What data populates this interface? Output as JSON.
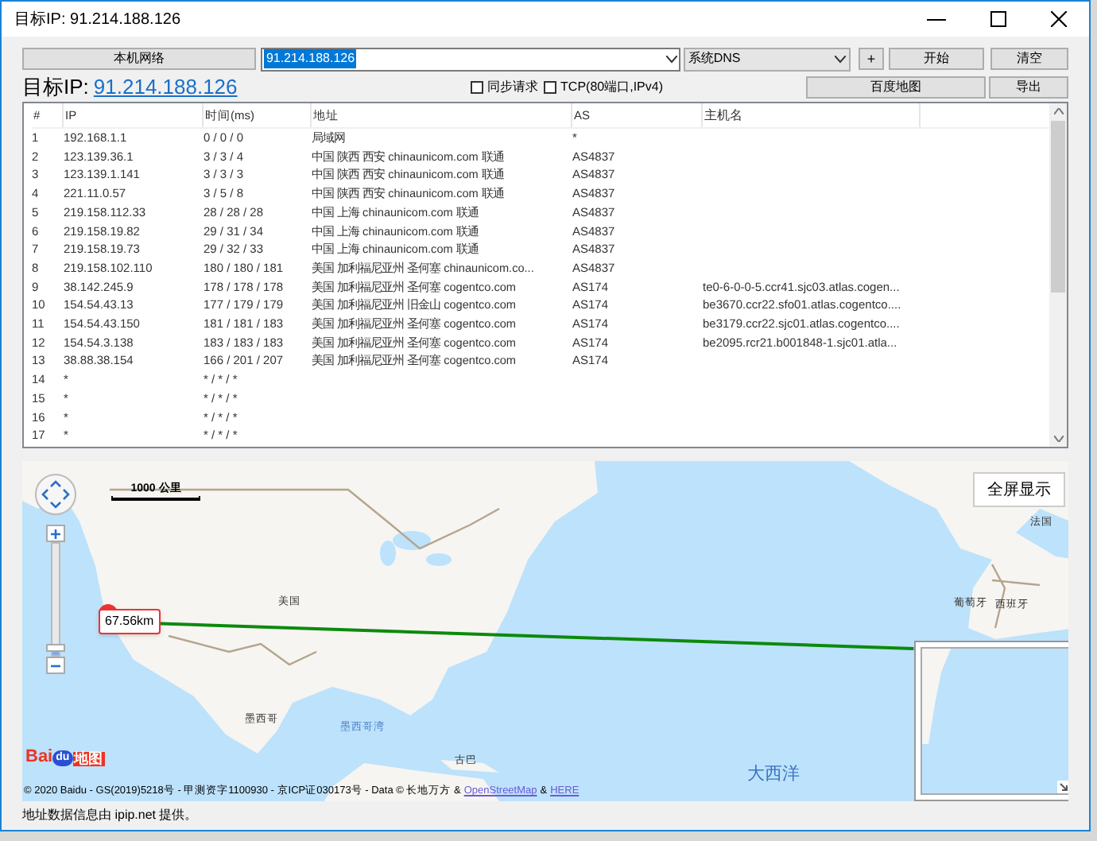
{
  "window": {
    "title": "目标IP: 91.214.188.126"
  },
  "toolbar": {
    "local_network_button": "本机网络",
    "ip_field": {
      "value": "91.214.188.126"
    },
    "dns_select": "系统DNS",
    "add_button": "+",
    "start_button": "开始",
    "clear_button": "清空"
  },
  "target": {
    "label": "目标IP:",
    "ip_link": "91.214.188.126"
  },
  "options": [
    {
      "label": "同步请求",
      "checked": false
    },
    {
      "label": "TCP(80端口,IPv4)",
      "checked": false
    }
  ],
  "map_button": "百度地图",
  "export_button": "导出",
  "table": {
    "columns": [
      "#",
      "IP",
      "时间(ms)",
      "地址",
      "AS",
      "主机名"
    ],
    "rows": [
      [
        "1",
        "192.168.1.1",
        "0 / 0 / 0",
        "局域网",
        "*",
        ""
      ],
      [
        "2",
        "123.139.36.1",
        "3 / 3 / 4",
        "中国 陕西 西安 chinaunicom.com 联通",
        "AS4837",
        ""
      ],
      [
        "3",
        "123.139.1.141",
        "3 / 3 / 3",
        "中国 陕西 西安 chinaunicom.com 联通",
        "AS4837",
        ""
      ],
      [
        "4",
        "221.11.0.57",
        "3 / 5 / 8",
        "中国 陕西 西安 chinaunicom.com 联通",
        "AS4837",
        ""
      ],
      [
        "5",
        "219.158.112.33",
        "28 / 28 / 28",
        "中国 上海 chinaunicom.com 联通",
        "AS4837",
        ""
      ],
      [
        "6",
        "219.158.19.82",
        "29 / 31 / 34",
        "中国 上海 chinaunicom.com 联通",
        "AS4837",
        ""
      ],
      [
        "7",
        "219.158.19.73",
        "29 / 32 / 33",
        "中国 上海 chinaunicom.com 联通",
        "AS4837",
        ""
      ],
      [
        "8",
        "219.158.102.110",
        "180 / 180 / 181",
        "美国 加利福尼亚州 圣何塞 chinaunicom.co...",
        "AS4837",
        ""
      ],
      [
        "9",
        "38.142.245.9",
        "178 / 178 / 178",
        "美国 加利福尼亚州 圣何塞 cogentco.com",
        "AS174",
        "te0-6-0-0-5.ccr41.sjc03.atlas.cogen..."
      ],
      [
        "10",
        "154.54.43.13",
        "177 / 179 / 179",
        "美国 加利福尼亚州 旧金山 cogentco.com",
        "AS174",
        "be3670.ccr22.sfo01.atlas.cogentco...."
      ],
      [
        "11",
        "154.54.43.150",
        "181 / 181 / 183",
        "美国 加利福尼亚州 圣何塞 cogentco.com",
        "AS174",
        "be3179.ccr22.sjc01.atlas.cogentco...."
      ],
      [
        "12",
        "154.54.3.138",
        "183 / 183 / 183",
        "美国 加利福尼亚州 圣何塞 cogentco.com",
        "AS174",
        "be2095.rcr21.b001848-1.sjc01.atla..."
      ],
      [
        "13",
        "38.88.38.154",
        "166 / 201 / 207",
        "美国 加利福尼亚州 圣何塞 cogentco.com",
        "AS174",
        ""
      ],
      [
        "14",
        "*",
        "* / * / *",
        "",
        "",
        ""
      ],
      [
        "15",
        "*",
        "* / * / *",
        "",
        "",
        ""
      ],
      [
        "16",
        "*",
        "* / * / *",
        "",
        "",
        ""
      ],
      [
        "17",
        "*",
        "* / * / *",
        "",
        "",
        ""
      ]
    ]
  },
  "map": {
    "scale": "1000 公里",
    "distance": "67.56km",
    "fullscreen_button": "全屏显示",
    "zoom_slider": {
      "level": 0.05
    },
    "labels": [
      {
        "text": "美国",
        "kind": "land"
      },
      {
        "text": "墨西哥",
        "kind": "land"
      },
      {
        "text": "墨西哥湾",
        "kind": "water"
      },
      {
        "text": "古巴",
        "kind": "land"
      },
      {
        "text": "法国",
        "kind": "land"
      },
      {
        "text": "葡萄牙",
        "kind": "land"
      },
      {
        "text": "西班牙",
        "kind": "land"
      },
      {
        "text": "大西洋",
        "kind": "ocean"
      }
    ],
    "logo": [
      "Bai",
      "du",
      "地图"
    ],
    "copyright": "© 2020 Baidu - GS(2019)5218号 - 甲测资字1100930 - 京ICP证030173号 - Data © 长地万方 &",
    "links": [
      "OpenStreetMap",
      "HERE"
    ],
    "copyright_sep": "&"
  },
  "footer": "地址数据信息由 ipip.net 提供。"
}
